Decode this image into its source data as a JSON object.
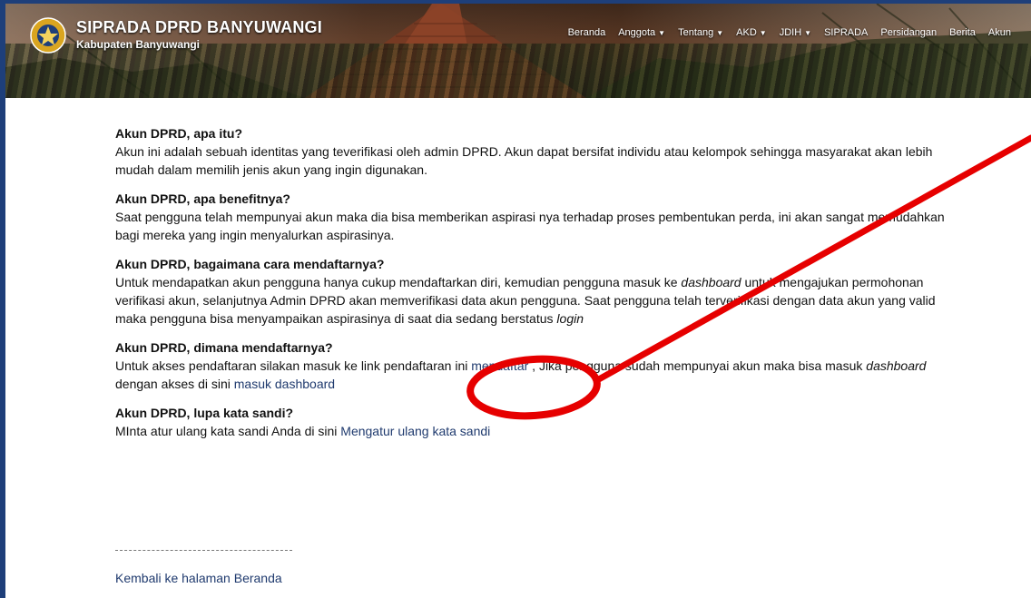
{
  "header": {
    "title": "SIPRADA DPRD BANYUWANGI",
    "subtitle": "Kabupaten Banyuwangi"
  },
  "nav": [
    {
      "label": "Beranda",
      "dropdown": false
    },
    {
      "label": "Anggota",
      "dropdown": true
    },
    {
      "label": "Tentang",
      "dropdown": true
    },
    {
      "label": "AKD",
      "dropdown": true
    },
    {
      "label": "JDIH",
      "dropdown": true
    },
    {
      "label": "SIPRADA",
      "dropdown": false
    },
    {
      "label": "Persidangan",
      "dropdown": false
    },
    {
      "label": "Berita",
      "dropdown": false
    },
    {
      "label": "Akun",
      "dropdown": false
    }
  ],
  "faq": [
    {
      "question": "Akun DPRD, apa itu?",
      "answer": "Akun ini adalah sebuah identitas yang teverifikasi oleh admin DPRD. Akun dapat bersifat individu atau kelompok sehingga masyarakat akan lebih mudah dalam memilih jenis akun yang ingin digunakan."
    },
    {
      "question": "Akun DPRD, apa benefitnya?",
      "answer": "Saat pengguna telah mempunyai akun maka dia bisa memberikan aspirasi nya terhadap proses pembentukan perda, ini akan sangat memudahkan bagi mereka yang ingin menyalurkan aspirasinya."
    },
    {
      "question": "Akun DPRD, bagaimana cara mendaftarnya?",
      "answer_part1": "Untuk mendapatkan akun pengguna hanya cukup mendaftarkan diri, kemudian pengguna masuk ke ",
      "answer_em1": "dashboard",
      "answer_part2": " untuk mengajukan permohonan verifikasi akun, selanjutnya Admin DPRD akan memverifikasi data akun pengguna. Saat pengguna telah terverifikasi dengan data akun yang valid maka pengguna bisa menyampaikan aspirasinya di saat dia sedang berstatus ",
      "answer_em2": "login"
    },
    {
      "question": "Akun DPRD, dimana mendaftarnya?",
      "answer_part1": "Untuk akses pendaftaran silakan masuk ke link pendaftaran ini ",
      "link1": "mendaftar",
      "answer_part2": " , Jika pengguna sudah mempunyai akun maka bisa masuk ",
      "answer_em1": "dashboard",
      "answer_part3": "  dengan akses di sini ",
      "link2": "masuk dashboard"
    },
    {
      "question": "Akun DPRD, lupa kata sandi?",
      "answer_part1": "MInta atur ulang kata sandi Anda di sini ",
      "link1": "Mengatur ulang kata sandi"
    }
  ],
  "footer": {
    "back_link": "Kembali ke halaman Beranda"
  },
  "colors": {
    "link": "#1f3a6e",
    "annotation": "#e60000",
    "page_border": "#1e3f7a"
  },
  "icons": {
    "logo": "dprd-emblem-icon"
  }
}
